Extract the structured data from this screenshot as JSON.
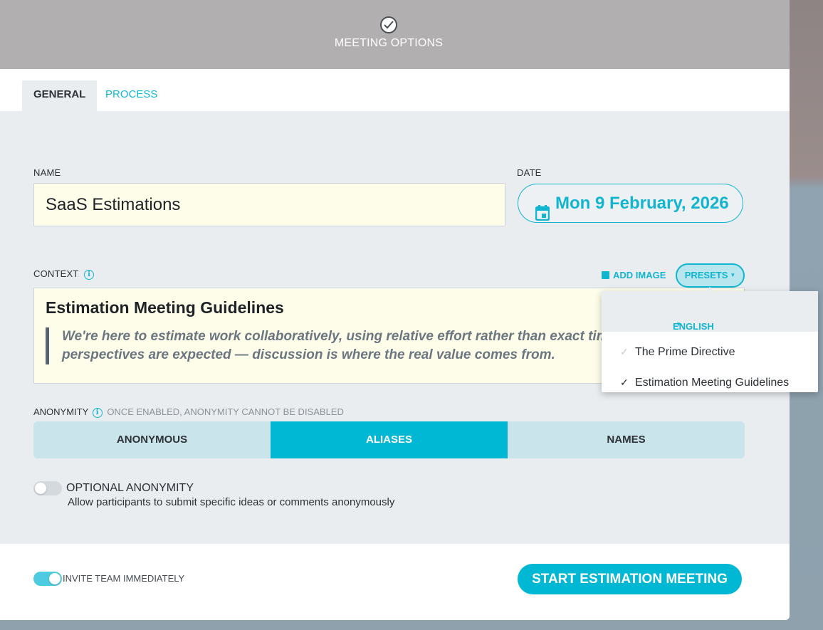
{
  "header": {
    "title": "MEETING OPTIONS"
  },
  "tabs": [
    {
      "label": "GENERAL"
    },
    {
      "label": "PROCESS"
    }
  ],
  "form": {
    "name_label": "NAME",
    "name_value": "SaaS Estimations",
    "date_label": "DATE",
    "date_value": "Mon 9 February, 2026",
    "context_label": "CONTEXT",
    "add_image_label": "ADD IMAGE",
    "presets_label": "PRESETS",
    "context_heading": "Estimation Meeting Guidelines",
    "context_quote": "We're here to estimate work collaboratively, using relative effort rather than exact time. Different perspectives are expected — discussion is where the real value comes from.",
    "anonymity_label": "ANONYMITY",
    "anonymity_note": "ONCE ENABLED, ANONYMITY CANNOT BE DISABLED",
    "anonymity_options": [
      "ANONYMOUS",
      "ALIASES",
      "NAMES"
    ],
    "anonymity_selected": "ALIASES",
    "optional_anonymity_title": "OPTIONAL ANONYMITY",
    "optional_anonymity_desc": "Allow participants to submit specific ideas or comments anonymously",
    "optional_anonymity_on": false
  },
  "footer": {
    "invite_label": "INVITE TEAM IMMEDIATELY",
    "invite_on": true,
    "start_button": "START ESTIMATION MEETING"
  },
  "presets_dropdown": {
    "language": "ENGLISH",
    "items": [
      {
        "label": "The Prime Directive",
        "checked": false
      },
      {
        "label": "Estimation Meeting Guidelines",
        "checked": true
      }
    ]
  },
  "colors": {
    "accent": "#00b8d4",
    "header_bg": "#b1afb0",
    "input_bg": "#fefde9"
  }
}
